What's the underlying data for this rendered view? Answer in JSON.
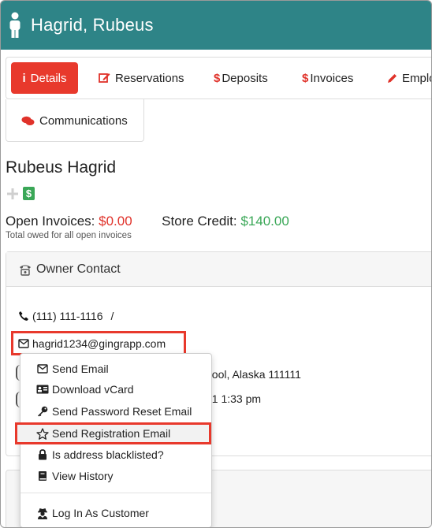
{
  "header": {
    "title": "Hagrid, Rubeus",
    "icon": "person-icon",
    "color": "#2e8487"
  },
  "tabs": [
    {
      "label": "Details",
      "icon": "info-icon",
      "active": true
    },
    {
      "label": "Reservations",
      "icon": "edit-icon"
    },
    {
      "label": "Deposits",
      "icon": "dollar-icon"
    },
    {
      "label": "Invoices",
      "icon": "dollar-icon"
    },
    {
      "label": "Emplo",
      "icon": "pencil-icon"
    },
    {
      "label": "Communications",
      "icon": "comments-icon"
    }
  ],
  "customer": {
    "name": "Rubeus Hagrid",
    "badge": "$",
    "open_invoices_label": "Open Invoices:",
    "open_invoices_value": "$0.00",
    "store_credit_label": "Store Credit:",
    "store_credit_value": "$140.00",
    "note": "Total owed for all open invoices"
  },
  "owner_contact": {
    "title": "Owner Contact",
    "phone": "(111) 111-1116",
    "separator": "/",
    "email": "hagrid1234@gingrapp.com",
    "address_fragment": "hool, Alaska 111111",
    "date_fragment": "21 1:33 pm"
  },
  "email_menu": {
    "items": [
      {
        "label": "Send Email",
        "icon": "envelope-icon"
      },
      {
        "label": "Download vCard",
        "icon": "vcard-icon"
      },
      {
        "label": "Send Password Reset Email",
        "icon": "key-icon"
      },
      {
        "label": "Send Registration Email",
        "icon": "star-icon",
        "highlighted": true
      },
      {
        "label": "Is address blacklisted?",
        "icon": "lock-icon"
      },
      {
        "label": "View History",
        "icon": "book-icon"
      },
      {
        "label": "Log In As Customer",
        "icon": "user-secret-icon"
      }
    ]
  },
  "colors": {
    "accent_red": "#e8392c",
    "money_red": "#e0322a",
    "money_green": "#3aa757"
  }
}
